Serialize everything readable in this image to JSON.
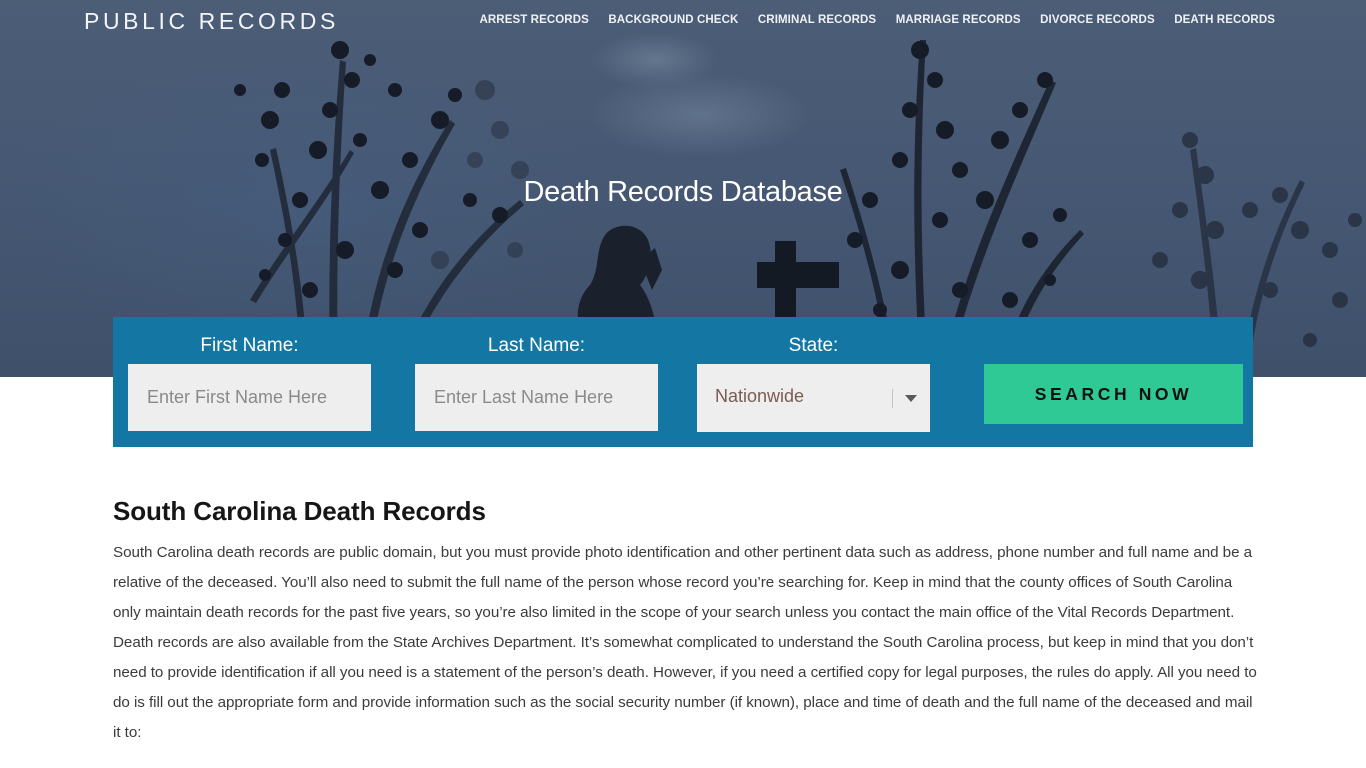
{
  "header": {
    "logo": "PUBLIC RECORDS",
    "nav": [
      {
        "label": "ARREST RECORDS"
      },
      {
        "label": "BACKGROUND CHECK"
      },
      {
        "label": "CRIMINAL RECORDS"
      },
      {
        "label": "MARRIAGE RECORDS"
      },
      {
        "label": "DIVORCE RECORDS"
      },
      {
        "label": "DEATH RECORDS"
      }
    ]
  },
  "hero": {
    "title": "Death Records Database"
  },
  "search": {
    "first_name": {
      "label": "First Name:",
      "placeholder": "Enter First Name Here",
      "value": ""
    },
    "last_name": {
      "label": "Last Name:",
      "placeholder": "Enter Last Name Here",
      "value": ""
    },
    "state": {
      "label": "State:",
      "selected": "Nationwide"
    },
    "submit_label": "SEARCH NOW"
  },
  "article": {
    "heading": "South Carolina Death Records",
    "paragraph": "South Carolina death records are public domain, but you must provide photo identification and other pertinent data such as address, phone number and full name and be a relative of the deceased. You’ll also need to submit the full name of the person whose record you’re searching for. Keep in mind that the county offices of South Carolina only maintain death records for the past five years, so you’re also limited in the scope of your search unless you contact the main office of the Vital Records Department. Death records are also available from the State Archives Department. It’s somewhat complicated to understand the South Carolina process, but keep in mind that you don’t need to provide identification if all you need is a statement of the person’s death. However, if you need a certified copy for legal purposes, the rules do apply. All you need to do is fill out the appropriate form and provide information such as the social security number (if known), place and time of death and the full name of the deceased and mail it to:"
  },
  "colors": {
    "panel": "#1477a3",
    "button": "#2ec995",
    "hero_bg": "#465873"
  }
}
